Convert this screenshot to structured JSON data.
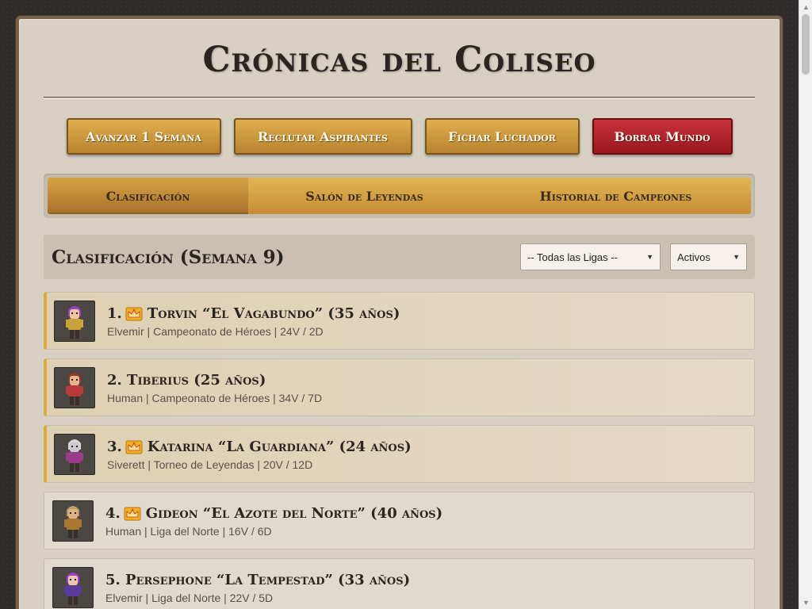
{
  "app": {
    "title": "Crónicas del Coliseo"
  },
  "actions": [
    {
      "label": "Avanzar 1 Semana"
    },
    {
      "label": "Reclutar Aspirantes"
    },
    {
      "label": "Fichar Luchador"
    },
    {
      "label": "Borrar Mundo"
    }
  ],
  "tabs": [
    {
      "label": "Clasificación",
      "active": true
    },
    {
      "label": "Salón de Leyendas"
    },
    {
      "label": "Historial de Campeones"
    }
  ],
  "standings": {
    "title": "Clasificación (Semana 9)",
    "league_filter": "-- Todas las Ligas --",
    "status_filter": "Activos",
    "rows": [
      {
        "name": "1. Torvin “El Vagabundo” (35 años)",
        "sub": "Elvemir | Campeonato de Héroes | 24V / 2D",
        "crown": true,
        "top": true,
        "hair": "#9b3fc8",
        "skin": "#f0c6a0",
        "body": "#c9a23a"
      },
      {
        "name": "2. Tiberius (25 años)",
        "sub": "Human | Campeonato de Héroes | 34V / 7D",
        "crown": false,
        "top": true,
        "hair": "#8a3b2a",
        "skin": "#e8b48e",
        "body": "#b83a3a"
      },
      {
        "name": "3. Katarina “La Guardiana” (24 años)",
        "sub": "Siverett | Torneo de Leyendas | 20V / 12D",
        "crown": true,
        "top": true,
        "hair": "#d8d8d8",
        "skin": "#cfc6cf",
        "body": "#9a3a8a"
      },
      {
        "name": "4. Gideon “El Azote del Norte” (40 años)",
        "sub": "Human | Liga del Norte | 16V / 6D",
        "crown": true,
        "top": false,
        "hair": "#b8a060",
        "skin": "#e0b08a",
        "body": "#a8782e"
      },
      {
        "name": "5. Persephone “La Tempestad” (33 años)",
        "sub": "Elvemir | Liga del Norte | 22V / 5D",
        "crown": false,
        "top": false,
        "hair": "#a040d0",
        "skin": "#f0c6b0",
        "body": "#5a3a9a"
      }
    ]
  }
}
